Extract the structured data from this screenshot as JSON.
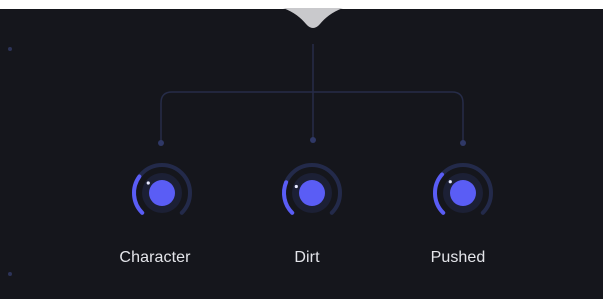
{
  "plugin": {
    "colors": {
      "background": "#15161c",
      "accent": "#5a5df5",
      "track": "#232a4a",
      "connector": "#262c48",
      "connector_dot": "#2f3866",
      "label": "#e4e5ea",
      "top_notch": "#c9c9cc"
    },
    "macro_notch_icon": "macro-source-notch",
    "knobs": [
      {
        "id": "character",
        "label": "Character",
        "value": 0.3
      },
      {
        "id": "dirt",
        "label": "Dirt",
        "value": 0.25
      },
      {
        "id": "pushed",
        "label": "Pushed",
        "value": 0.32
      }
    ]
  }
}
